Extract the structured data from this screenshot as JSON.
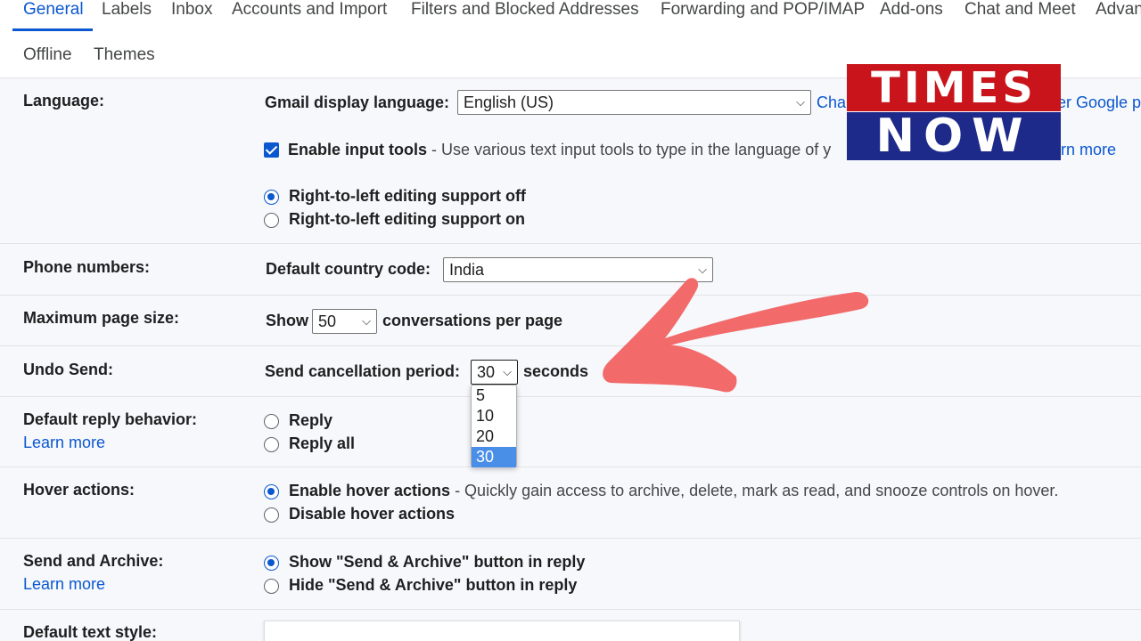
{
  "tabs": {
    "general": "General",
    "labels": "Labels",
    "inbox": "Inbox",
    "accounts": "Accounts and Import",
    "filters": "Filters and Blocked Addresses",
    "forwarding": "Forwarding and POP/IMAP",
    "addons": "Add-ons",
    "chat": "Chat and Meet",
    "advanced": "Advan",
    "offline": "Offline",
    "themes": "Themes"
  },
  "language": {
    "label": "Language:",
    "display_label": "Gmail display language:",
    "display_value": "English (US)",
    "change_link": "Cha",
    "other_link": "er Google p",
    "input_tools_label": "Enable input tools",
    "input_tools_desc": " - Use various text input tools to type in the language of y",
    "learn_more_partial": "rn more",
    "rtl_off": "Right-to-left editing support off",
    "rtl_on": "Right-to-left editing support on"
  },
  "phone": {
    "label": "Phone numbers:",
    "country_label": "Default country code:",
    "country_value": "India"
  },
  "page_size": {
    "label": "Maximum page size:",
    "show": "Show",
    "value": "50",
    "suffix": "conversations per page"
  },
  "undo_send": {
    "label": "Undo Send:",
    "period_label": "Send cancellation period:",
    "value": "30",
    "suffix": "seconds",
    "options": [
      "5",
      "10",
      "20",
      "30"
    ],
    "selected": "30"
  },
  "reply": {
    "label": "Default reply behavior:",
    "learn_more": "Learn more",
    "reply": "Reply",
    "reply_all": "Reply all"
  },
  "hover": {
    "label": "Hover actions:",
    "enable": "Enable hover actions",
    "enable_desc": " - Quickly gain access to archive, delete, mark as read, and snooze controls on hover.",
    "disable": "Disable hover actions"
  },
  "send_archive": {
    "label": "Send and Archive:",
    "learn_more": "Learn more",
    "show": "Show \"Send & Archive\" button in reply",
    "hide": "Hide \"Send & Archive\" button in reply"
  },
  "text_style": {
    "label": "Default text style:"
  },
  "logo": {
    "top": "TIMES",
    "bottom": "NOW"
  },
  "colors": {
    "accent": "#0b57d0",
    "arrow": "#f26a6a",
    "logo_red": "#c8141a",
    "logo_blue": "#1e2a8a"
  }
}
